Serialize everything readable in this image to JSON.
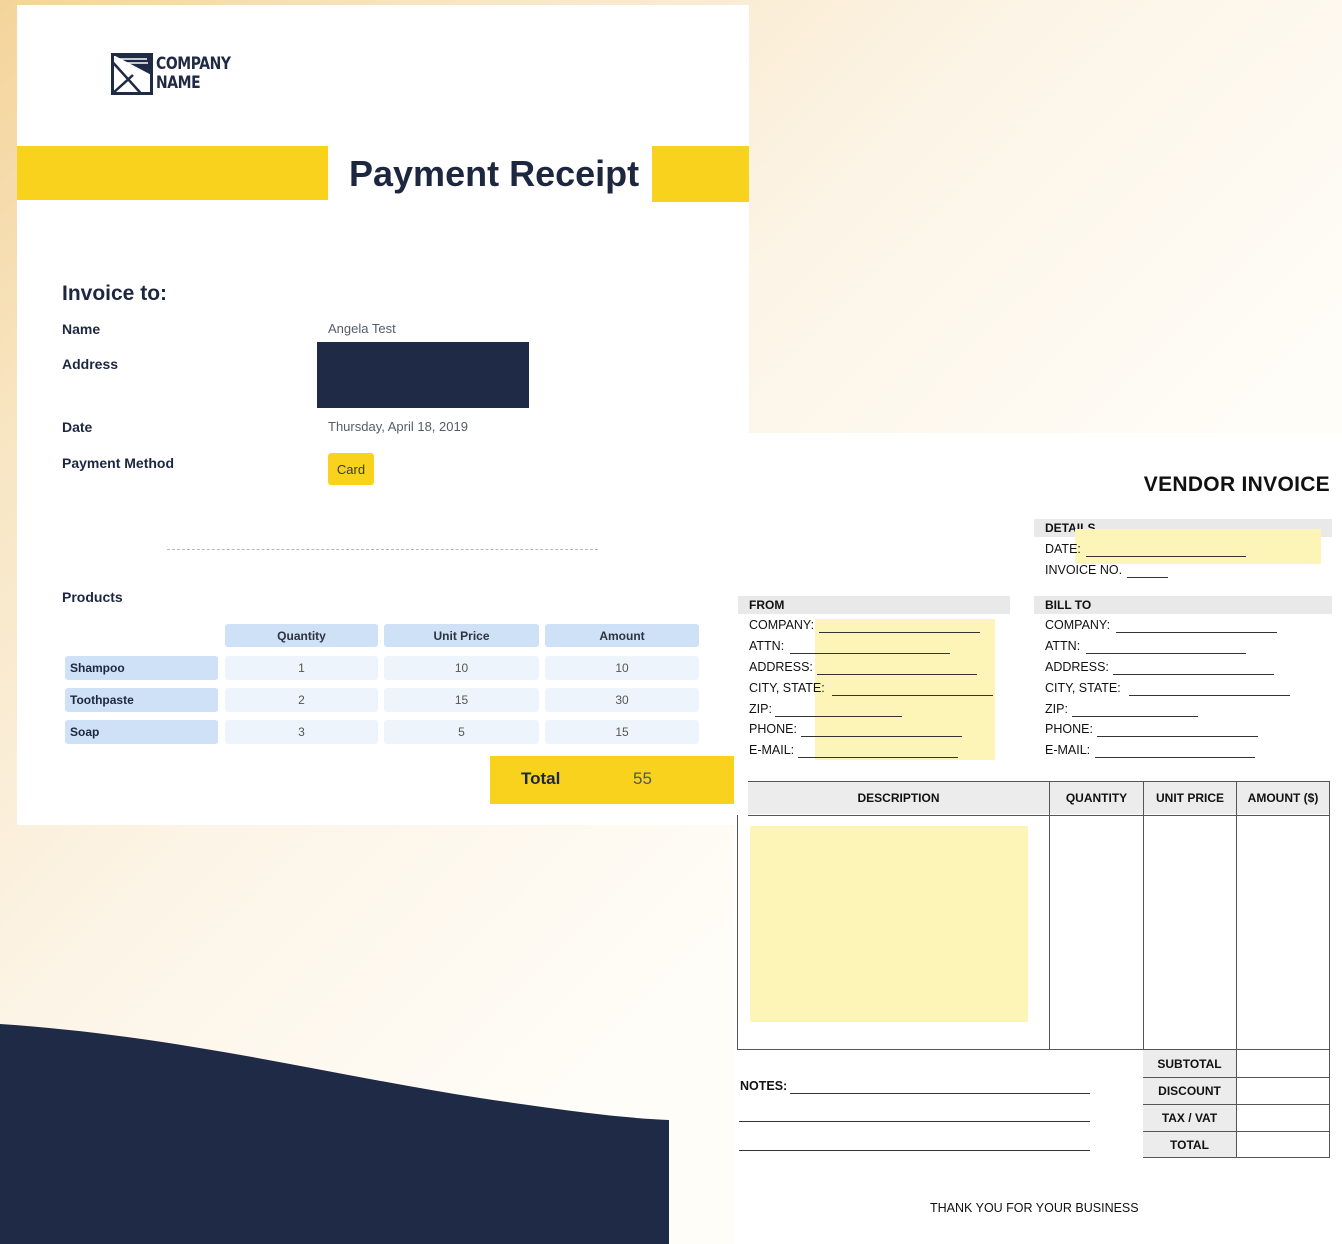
{
  "receipt": {
    "logo": {
      "icon": "envelope-triangle-logo",
      "line1": "COMPANY",
      "line2": "NAME"
    },
    "title": "Payment Receipt",
    "invoice_to": "Invoice to:",
    "name_label": "Name",
    "name_value": "Angela Test",
    "address_label": "Address",
    "date_label": "Date",
    "date_value": "Thursday, April 18, 2019",
    "payment_method_label": "Payment Method",
    "payment_method_value": "Card",
    "products_label": "Products",
    "table": {
      "headers": [
        "Quantity",
        "Unit Price",
        "Amount"
      ],
      "rows": [
        {
          "product": "Shampoo",
          "quantity": "1",
          "unit_price": "10",
          "amount": "10"
        },
        {
          "product": "Toothpaste",
          "quantity": "2",
          "unit_price": "15",
          "amount": "30"
        },
        {
          "product": "Soap",
          "quantity": "3",
          "unit_price": "5",
          "amount": "15"
        }
      ]
    },
    "total_label": "Total",
    "total_value": "55",
    "colors": {
      "accent_yellow": "#f8d21c",
      "navy": "#1e2a46",
      "light_blue": "#cfe1f6"
    }
  },
  "vendor_invoice": {
    "title": "VENDOR INVOICE",
    "details": {
      "header": "DETAILS",
      "date": "DATE:",
      "invoice_no": "INVOICE NO."
    },
    "from": {
      "header": "FROM",
      "company": "COMPANY:",
      "attn": "ATTN:",
      "address": "ADDRESS:",
      "city_state": "CITY, STATE:",
      "zip": "ZIP:",
      "phone": "PHONE:",
      "email": "E-MAIL:"
    },
    "bill_to": {
      "header": "BILL TO",
      "company": "COMPANY:",
      "attn": "ATTN:",
      "address": "ADDRESS:",
      "city_state": "CITY, STATE:",
      "zip": "ZIP:",
      "phone": "PHONE:",
      "email": "E-MAIL:"
    },
    "columns": {
      "description": "DESCRIPTION",
      "quantity": "QUANTITY",
      "unit_price": "UNIT PRICE",
      "amount": "AMOUNT ($)"
    },
    "summary": {
      "subtotal": "SUBTOTAL",
      "discount": "DISCOUNT",
      "tax": "TAX / VAT",
      "total": "TOTAL"
    },
    "notes_label": "NOTES:",
    "footer": "THANK YOU FOR YOUR BUSINESS",
    "colors": {
      "highlight": "#fdf4b8",
      "header_gray": "#e9e9e9"
    }
  },
  "background": {
    "wave_color": "#1e2a46"
  }
}
